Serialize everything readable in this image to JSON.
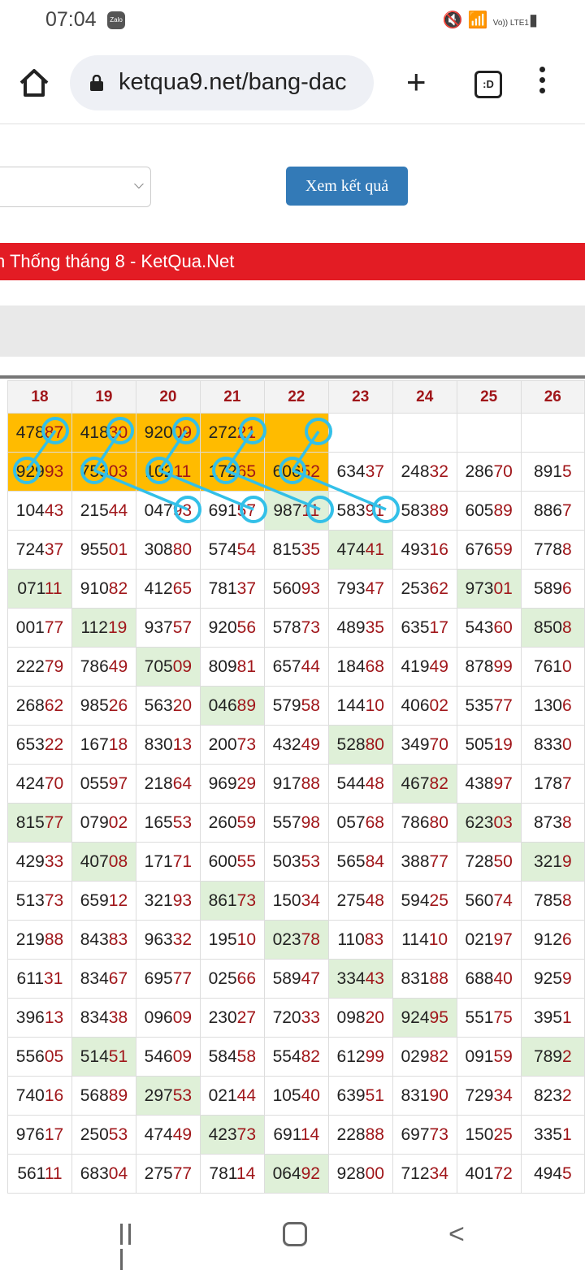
{
  "status_bar": {
    "time": "07:04",
    "app_icon": "Zalo",
    "right_indicators": "Vo)) LTE1",
    "icons": [
      "mute-icon",
      "wifi-icon",
      "signal-icon",
      "battery-icon"
    ]
  },
  "browser": {
    "url": "ketqua9.net/bang-dac",
    "tabs_label": ":D",
    "icons": [
      "home-icon",
      "lock-icon",
      "plus-icon",
      "tabs-icon",
      "menu-icon"
    ]
  },
  "form": {
    "select_value": "",
    "submit_label": "Xem kết quả"
  },
  "banner": {
    "title": "n Thống tháng 8 - KetQua.Net"
  },
  "table": {
    "headers": [
      "18",
      "19",
      "20",
      "21",
      "22",
      "23",
      "24",
      "25",
      "26"
    ],
    "rows": [
      [
        [
          "478",
          "87",
          "hl"
        ],
        [
          "418",
          "30",
          "hl"
        ],
        [
          "920",
          "09",
          "hl"
        ],
        [
          "272",
          "21",
          "hl"
        ],
        [
          "",
          "",
          "hl"
        ],
        [
          "",
          "",
          ""
        ],
        [
          "",
          "",
          ""
        ],
        [
          "",
          "",
          ""
        ],
        [
          "",
          "",
          ""
        ]
      ],
      [
        [
          "929",
          "93",
          "hl"
        ],
        [
          "753",
          "03",
          "hl"
        ],
        [
          "102",
          "11",
          "hl"
        ],
        [
          "172",
          "65",
          "hl"
        ],
        [
          "606",
          "52",
          "hl"
        ],
        [
          "634",
          "37",
          ""
        ],
        [
          "248",
          "32",
          ""
        ],
        [
          "286",
          "70",
          ""
        ],
        [
          "891",
          "5",
          ""
        ]
      ],
      [
        [
          "104",
          "43",
          ""
        ],
        [
          "215",
          "44",
          ""
        ],
        [
          "047",
          "93",
          ""
        ],
        [
          "691",
          "57",
          ""
        ],
        [
          "987",
          "11",
          "gr"
        ],
        [
          "583",
          "91",
          ""
        ],
        [
          "583",
          "89",
          ""
        ],
        [
          "605",
          "89",
          ""
        ],
        [
          "886",
          "7",
          ""
        ]
      ],
      [
        [
          "724",
          "37",
          ""
        ],
        [
          "955",
          "01",
          ""
        ],
        [
          "308",
          "80",
          ""
        ],
        [
          "574",
          "54",
          ""
        ],
        [
          "815",
          "35",
          ""
        ],
        [
          "474",
          "41",
          "gr"
        ],
        [
          "493",
          "16",
          ""
        ],
        [
          "676",
          "59",
          ""
        ],
        [
          "778",
          "8",
          ""
        ]
      ],
      [
        [
          "071",
          "11",
          "gr"
        ],
        [
          "910",
          "82",
          ""
        ],
        [
          "412",
          "65",
          ""
        ],
        [
          "781",
          "37",
          ""
        ],
        [
          "560",
          "93",
          ""
        ],
        [
          "793",
          "47",
          ""
        ],
        [
          "253",
          "62",
          ""
        ],
        [
          "973",
          "01",
          "gr"
        ],
        [
          "589",
          "6",
          ""
        ]
      ],
      [
        [
          "001",
          "77",
          ""
        ],
        [
          "112",
          "19",
          "gr"
        ],
        [
          "937",
          "57",
          ""
        ],
        [
          "920",
          "56",
          ""
        ],
        [
          "578",
          "73",
          ""
        ],
        [
          "489",
          "35",
          ""
        ],
        [
          "635",
          "17",
          ""
        ],
        [
          "543",
          "60",
          ""
        ],
        [
          "850",
          "8",
          "gr"
        ]
      ],
      [
        [
          "222",
          "79",
          ""
        ],
        [
          "786",
          "49",
          ""
        ],
        [
          "705",
          "09",
          "gr"
        ],
        [
          "809",
          "81",
          ""
        ],
        [
          "657",
          "44",
          ""
        ],
        [
          "184",
          "68",
          ""
        ],
        [
          "419",
          "49",
          ""
        ],
        [
          "878",
          "99",
          ""
        ],
        [
          "761",
          "0",
          ""
        ]
      ],
      [
        [
          "268",
          "62",
          ""
        ],
        [
          "985",
          "26",
          ""
        ],
        [
          "563",
          "20",
          ""
        ],
        [
          "046",
          "89",
          "gr"
        ],
        [
          "579",
          "58",
          ""
        ],
        [
          "144",
          "10",
          ""
        ],
        [
          "406",
          "02",
          ""
        ],
        [
          "535",
          "77",
          ""
        ],
        [
          "130",
          "6",
          ""
        ]
      ],
      [
        [
          "653",
          "22",
          ""
        ],
        [
          "167",
          "18",
          ""
        ],
        [
          "830",
          "13",
          ""
        ],
        [
          "200",
          "73",
          ""
        ],
        [
          "432",
          "49",
          ""
        ],
        [
          "528",
          "80",
          "gr"
        ],
        [
          "349",
          "70",
          ""
        ],
        [
          "505",
          "19",
          ""
        ],
        [
          "833",
          "0",
          ""
        ]
      ],
      [
        [
          "424",
          "70",
          ""
        ],
        [
          "055",
          "97",
          ""
        ],
        [
          "218",
          "64",
          ""
        ],
        [
          "969",
          "29",
          ""
        ],
        [
          "917",
          "88",
          ""
        ],
        [
          "544",
          "48",
          ""
        ],
        [
          "467",
          "82",
          "gr"
        ],
        [
          "438",
          "97",
          ""
        ],
        [
          "178",
          "7",
          ""
        ]
      ],
      [
        [
          "815",
          "77",
          "gr"
        ],
        [
          "079",
          "02",
          ""
        ],
        [
          "165",
          "53",
          ""
        ],
        [
          "260",
          "59",
          ""
        ],
        [
          "557",
          "98",
          ""
        ],
        [
          "057",
          "68",
          ""
        ],
        [
          "786",
          "80",
          ""
        ],
        [
          "623",
          "03",
          "gr"
        ],
        [
          "873",
          "8",
          ""
        ]
      ],
      [
        [
          "429",
          "33",
          ""
        ],
        [
          "407",
          "08",
          "gr"
        ],
        [
          "171",
          "71",
          ""
        ],
        [
          "600",
          "55",
          ""
        ],
        [
          "503",
          "53",
          ""
        ],
        [
          "565",
          "84",
          ""
        ],
        [
          "388",
          "77",
          ""
        ],
        [
          "728",
          "50",
          ""
        ],
        [
          "321",
          "9",
          "gr"
        ]
      ],
      [
        [
          "513",
          "73",
          ""
        ],
        [
          "659",
          "12",
          ""
        ],
        [
          "321",
          "93",
          ""
        ],
        [
          "861",
          "73",
          "gr"
        ],
        [
          "150",
          "34",
          ""
        ],
        [
          "275",
          "48",
          ""
        ],
        [
          "594",
          "25",
          ""
        ],
        [
          "560",
          "74",
          ""
        ],
        [
          "785",
          "8",
          ""
        ]
      ],
      [
        [
          "219",
          "88",
          ""
        ],
        [
          "843",
          "83",
          ""
        ],
        [
          "963",
          "32",
          ""
        ],
        [
          "195",
          "10",
          ""
        ],
        [
          "023",
          "78",
          "gr"
        ],
        [
          "110",
          "83",
          ""
        ],
        [
          "114",
          "10",
          ""
        ],
        [
          "021",
          "97",
          ""
        ],
        [
          "912",
          "6",
          ""
        ]
      ],
      [
        [
          "611",
          "31",
          ""
        ],
        [
          "834",
          "67",
          ""
        ],
        [
          "695",
          "77",
          ""
        ],
        [
          "025",
          "66",
          ""
        ],
        [
          "589",
          "47",
          ""
        ],
        [
          "334",
          "43",
          "gr"
        ],
        [
          "831",
          "88",
          ""
        ],
        [
          "688",
          "40",
          ""
        ],
        [
          "925",
          "9",
          ""
        ]
      ],
      [
        [
          "396",
          "13",
          ""
        ],
        [
          "834",
          "38",
          ""
        ],
        [
          "096",
          "09",
          ""
        ],
        [
          "230",
          "27",
          ""
        ],
        [
          "720",
          "33",
          ""
        ],
        [
          "098",
          "20",
          ""
        ],
        [
          "924",
          "95",
          "gr"
        ],
        [
          "551",
          "75",
          ""
        ],
        [
          "395",
          "1",
          ""
        ]
      ],
      [
        [
          "556",
          "05",
          ""
        ],
        [
          "514",
          "51",
          "gr"
        ],
        [
          "546",
          "09",
          ""
        ],
        [
          "584",
          "58",
          ""
        ],
        [
          "554",
          "82",
          ""
        ],
        [
          "612",
          "99",
          ""
        ],
        [
          "029",
          "82",
          ""
        ],
        [
          "091",
          "59",
          ""
        ],
        [
          "789",
          "2",
          "gr"
        ]
      ],
      [
        [
          "740",
          "16",
          ""
        ],
        [
          "568",
          "89",
          ""
        ],
        [
          "297",
          "53",
          "gr"
        ],
        [
          "021",
          "44",
          ""
        ],
        [
          "105",
          "40",
          ""
        ],
        [
          "639",
          "51",
          ""
        ],
        [
          "831",
          "90",
          ""
        ],
        [
          "729",
          "34",
          ""
        ],
        [
          "823",
          "2",
          ""
        ]
      ],
      [
        [
          "976",
          "17",
          ""
        ],
        [
          "250",
          "53",
          ""
        ],
        [
          "474",
          "49",
          ""
        ],
        [
          "423",
          "73",
          "gr"
        ],
        [
          "691",
          "14",
          ""
        ],
        [
          "228",
          "88",
          ""
        ],
        [
          "697",
          "73",
          ""
        ],
        [
          "150",
          "25",
          ""
        ],
        [
          "335",
          "1",
          ""
        ]
      ],
      [
        [
          "561",
          "11",
          ""
        ],
        [
          "683",
          "04",
          ""
        ],
        [
          "275",
          "77",
          ""
        ],
        [
          "781",
          "14",
          ""
        ],
        [
          "064",
          "92",
          "gr"
        ],
        [
          "928",
          "00",
          ""
        ],
        [
          "712",
          "34",
          ""
        ],
        [
          "401",
          "72",
          ""
        ],
        [
          "494",
          "5",
          ""
        ]
      ]
    ]
  },
  "annotation_color": "#33c0e8",
  "highlight_color": "#ffbb00",
  "win_cell_color": "#dff0d8",
  "number_accent_color": "#a0161a"
}
